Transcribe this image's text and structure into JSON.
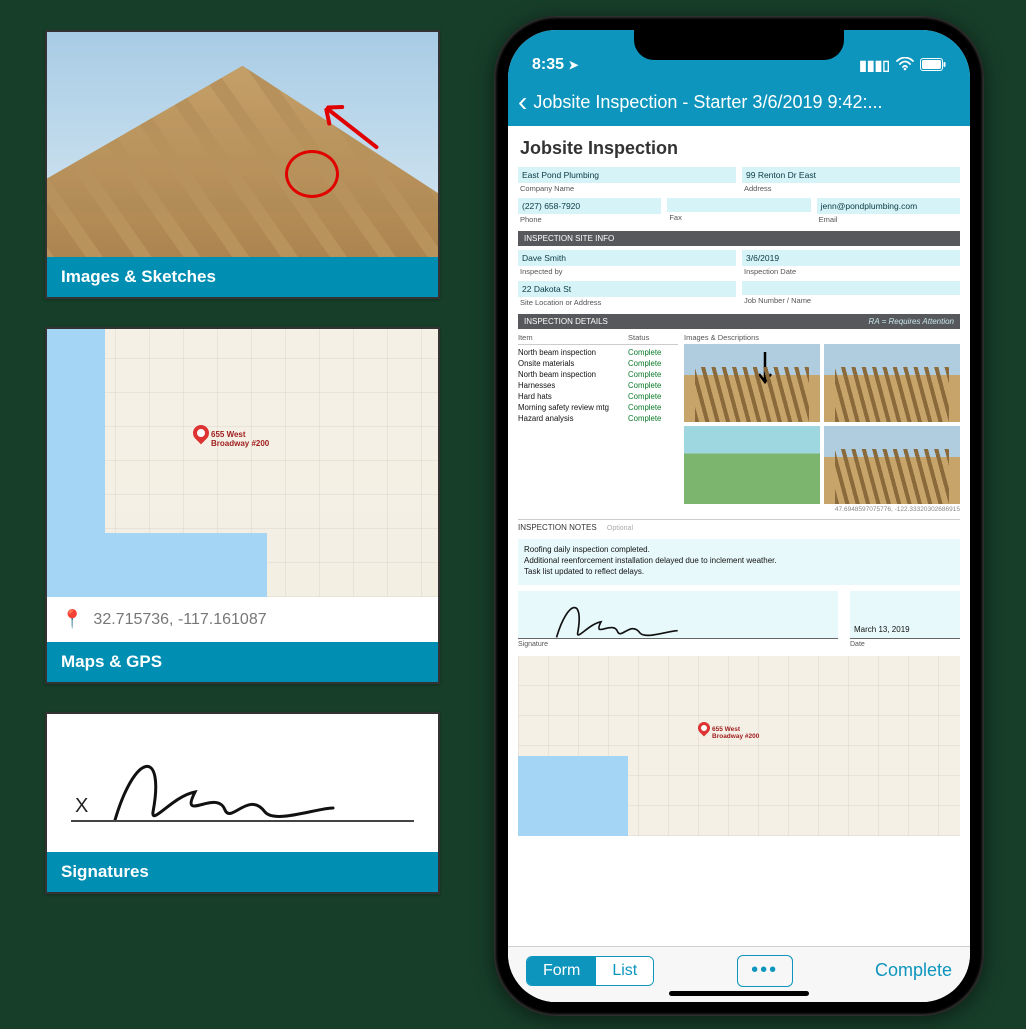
{
  "cards": {
    "images": {
      "footer": "Images & Sketches"
    },
    "maps": {
      "gps": "32.715736, -117.161087",
      "pin_label": "655 West\nBroadway #200",
      "footer": "Maps & GPS"
    },
    "signatures": {
      "x": "X",
      "footer": "Signatures"
    }
  },
  "phone": {
    "status": {
      "time": "8:35",
      "loc_icon": "➤"
    },
    "nav": {
      "back": "‹",
      "title": "Jobsite Inspection - Starter 3/6/2019 9:42:..."
    },
    "form": {
      "title": "Jobsite Inspection",
      "company": {
        "value": "East Pond Plumbing",
        "label": "Company Name"
      },
      "address": {
        "value": "99 Renton Dr East",
        "label": "Address"
      },
      "phone": {
        "value": "(227) 658-7920",
        "label": "Phone"
      },
      "fax": {
        "value": "",
        "label": "Fax"
      },
      "email": {
        "value": "jenn@pondplumbing.com",
        "label": "Email"
      },
      "sections": {
        "site_info": "INSPECTION SITE INFO",
        "details": "INSPECTION DETAILS",
        "details_ra": "RA = Requires Attention",
        "notes": "INSPECTION NOTES",
        "notes_tag": "Optional"
      },
      "inspector": {
        "value": "Dave Smith",
        "label": "Inspected by"
      },
      "date": {
        "value": "3/6/2019",
        "label": "Inspection Date"
      },
      "siteloc": {
        "value": "22 Dakota St",
        "label": "Site Location or Address"
      },
      "jobnum": {
        "value": "",
        "label": "Job Number / Name"
      },
      "det_headers": {
        "item": "Item",
        "status": "Status",
        "images": "Images & Descriptions"
      },
      "det_rows": [
        {
          "item": "North beam inspection",
          "status": "Complete"
        },
        {
          "item": "Onsite materials",
          "status": "Complete"
        },
        {
          "item": "North beam inspection",
          "status": "Complete"
        },
        {
          "item": "Harnesses",
          "status": "Complete"
        },
        {
          "item": "Hard hats",
          "status": "Complete"
        },
        {
          "item": "Morning safety review mtg",
          "status": "Complete"
        },
        {
          "item": "Hazard analysis",
          "status": "Complete"
        }
      ],
      "coords": "47.6948597075776, -122.33320302686915",
      "notes_text": "Roofing daily inspection completed.\nAdditional reenforcement installation delayed due to inclement weather.\nTask list updated to reflect delays.",
      "signature": {
        "label": "Signature"
      },
      "sig_date": {
        "value": "March 13, 2019",
        "label": "Date"
      },
      "map_pin_label": "655 West\nBroadway #200"
    },
    "tabbar": {
      "form": "Form",
      "list": "List",
      "more_icon": "•••",
      "complete": "Complete"
    }
  }
}
